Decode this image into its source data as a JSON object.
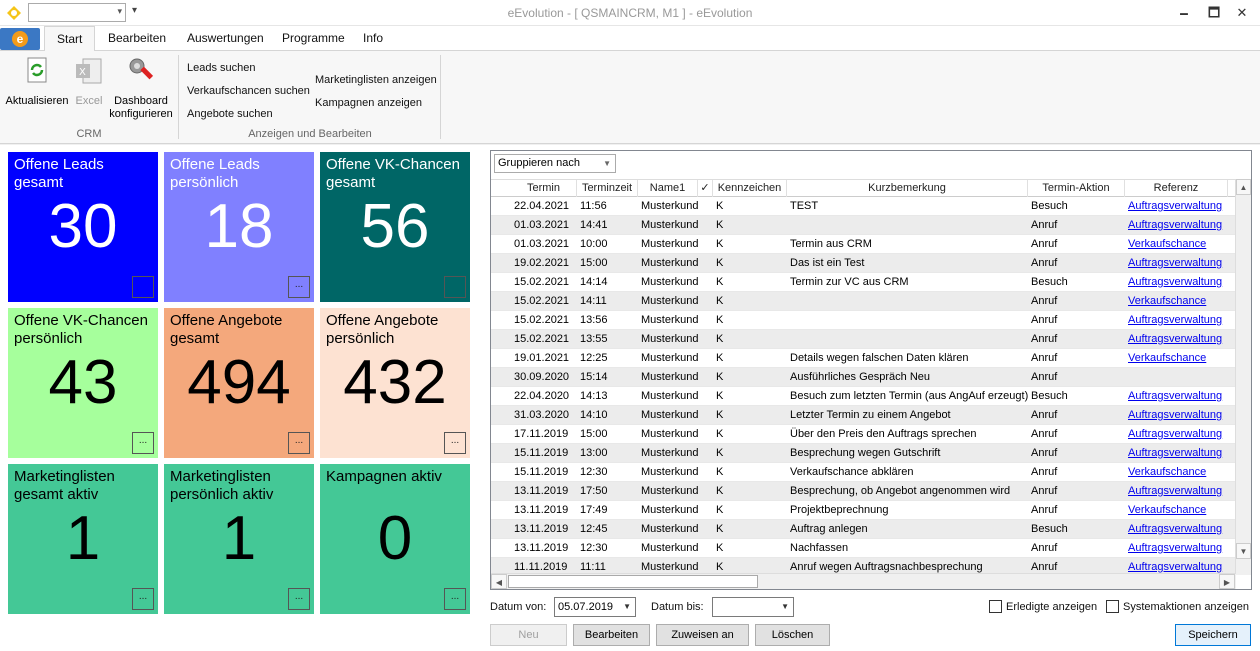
{
  "window": {
    "title": "eEvolution - [ QSMAINCRM, M1 ] -  eEvolution",
    "minimize": "🗕",
    "maximize": "🗖",
    "close": "✕",
    "quick_access_value": "",
    "quick_access_more": "▾"
  },
  "tabs": [
    {
      "label": "Start",
      "active": true
    },
    {
      "label": "Bearbeiten"
    },
    {
      "label": "Auswertungen"
    },
    {
      "label": "Programme"
    },
    {
      "label": "Info"
    }
  ],
  "app_button": "e",
  "ribbon": {
    "refresh": "Aktualisieren",
    "excel": "Excel",
    "dashboard_line1": "Dashboard",
    "dashboard_line2": "konfigurieren",
    "group_crm": "CRM",
    "leads_search": "Leads suchen",
    "opps_search": "Verkaufschancen suchen",
    "offers_search": "Angebote suchen",
    "marketing_lists": "Marketinglisten anzeigen",
    "campaigns": "Kampagnen anzeigen",
    "group_view_edit": "Anzeigen und Bearbeiten"
  },
  "tiles": [
    {
      "title": "Offene Leads gesamt",
      "value": "30",
      "bg": "#0000ff",
      "fg": "#ffffff",
      "btn": ""
    },
    {
      "title": "Offene Leads persönlich",
      "value": "18",
      "bg": "#8080ff",
      "fg": "#ffffff",
      "btn": "..."
    },
    {
      "title": "Offene VK-Chancen gesamt",
      "value": "56",
      "bg": "#006666",
      "fg": "#ffffff",
      "btn": ""
    },
    {
      "title": "Offene VK-Chancen persönlich",
      "value": "43",
      "bg": "#a6ff9c",
      "fg": "#000000",
      "btn": "..."
    },
    {
      "title": "Offene Angebote gesamt",
      "value": "494",
      "bg": "#f4a87c",
      "fg": "#000000",
      "btn": "..."
    },
    {
      "title": "Offene Angebote persönlich",
      "value": "432",
      "bg": "#fde2d2",
      "fg": "#000000",
      "btn": "..."
    },
    {
      "title": "Marketinglisten gesamt aktiv",
      "value": "1",
      "bg": "#44c896",
      "fg": "#000000",
      "btn": "..."
    },
    {
      "title": "Marketinglisten persönlich aktiv",
      "value": "1",
      "bg": "#44c896",
      "fg": "#000000",
      "btn": "..."
    },
    {
      "title": "Kampagnen aktiv",
      "value": "0",
      "bg": "#44c896",
      "fg": "#000000",
      "btn": "..."
    }
  ],
  "grid": {
    "group_by": "Gruppieren nach",
    "columns": [
      "Termin",
      "Terminzeit",
      "Name1",
      "✓",
      "Kennzeichen",
      "Kurzbemerkung",
      "Termin-Aktion",
      "Referenz"
    ],
    "rows": [
      [
        "22.04.2021",
        "11:56",
        "Musterkunde",
        "",
        "K",
        "TEST",
        "Besuch",
        "Auftragsverwaltung"
      ],
      [
        "01.03.2021",
        "14:41",
        "Musterkunde",
        "",
        "K",
        "",
        "Anruf",
        "Auftragsverwaltung"
      ],
      [
        "01.03.2021",
        "10:00",
        "Musterkunde",
        "",
        "K",
        "Termin aus CRM",
        "Anruf",
        "Verkaufschance"
      ],
      [
        "19.02.2021",
        "15:00",
        "Musterkunde",
        "",
        "K",
        "Das ist ein Test",
        "Anruf",
        "Auftragsverwaltung"
      ],
      [
        "15.02.2021",
        "14:14",
        "Musterkunde",
        "",
        "K",
        "Termin zur VC aus CRM",
        "Besuch",
        "Auftragsverwaltung"
      ],
      [
        "15.02.2021",
        "14:11",
        "Musterkunde",
        "",
        "K",
        "",
        "Anruf",
        "Verkaufschance"
      ],
      [
        "15.02.2021",
        "13:56",
        "Musterkunde",
        "",
        "K",
        "",
        "Anruf",
        "Auftragsverwaltung"
      ],
      [
        "15.02.2021",
        "13:55",
        "Musterkunde",
        "",
        "K",
        "",
        "Anruf",
        "Auftragsverwaltung"
      ],
      [
        "19.01.2021",
        "12:25",
        "Musterkunde",
        "",
        "K",
        "Details wegen falschen Daten klären",
        "Anruf",
        "Verkaufschance"
      ],
      [
        "30.09.2020",
        "15:14",
        "Musterkunde",
        "",
        "K",
        "Ausführliches Gespräch Neu",
        "Anruf",
        ""
      ],
      [
        "22.04.2020",
        "14:13",
        "Musterkunde",
        "",
        "K",
        "Besuch zum letzten Termin (aus AngAuf erzeugt)",
        "Besuch",
        "Auftragsverwaltung"
      ],
      [
        "31.03.2020",
        "14:10",
        "Musterkunde",
        "",
        "K",
        "Letzter Termin zu einem Angebot",
        "Anruf",
        "Auftragsverwaltung"
      ],
      [
        "17.11.2019",
        "15:00",
        "Musterkunde",
        "",
        "K",
        "Über den Preis den Auftrags sprechen",
        "Anruf",
        "Auftragsverwaltung"
      ],
      [
        "15.11.2019",
        "13:00",
        "Musterkunde",
        "",
        "K",
        "Besprechung wegen Gutschrift",
        "Anruf",
        "Auftragsverwaltung"
      ],
      [
        "15.11.2019",
        "12:30",
        "Musterkunde",
        "",
        "K",
        "Verkaufschance abklären",
        "Anruf",
        "Verkaufschance"
      ],
      [
        "13.11.2019",
        "17:50",
        "Musterkunde",
        "",
        "K",
        "Besprechung, ob Angebot angenommen wird",
        "Anruf",
        "Auftragsverwaltung"
      ],
      [
        "13.11.2019",
        "17:49",
        "Musterkunde",
        "",
        "K",
        "Projektbeprechnung",
        "Anruf",
        "Verkaufschance"
      ],
      [
        "13.11.2019",
        "12:45",
        "Musterkunde",
        "",
        "K",
        "Auftrag anlegen",
        "Besuch",
        "Auftragsverwaltung"
      ],
      [
        "13.11.2019",
        "12:30",
        "Musterkunde",
        "",
        "K",
        "Nachfassen",
        "Anruf",
        "Auftragsverwaltung"
      ],
      [
        "11.11.2019",
        "11:11",
        "Musterkunde",
        "",
        "K",
        "Anruf wegen Auftragsnachbesprechung",
        "Anruf",
        "Auftragsverwaltung"
      ]
    ]
  },
  "filters": {
    "date_from_label": "Datum von:",
    "date_from": "05.07.2019",
    "date_to_label": "Datum bis:",
    "date_to": "",
    "done_label": "Erledigte anzeigen",
    "system_label": "Systemaktionen anzeigen"
  },
  "buttons": {
    "new": "Neu",
    "edit": "Bearbeiten",
    "assign": "Zuweisen an",
    "delete": "Löschen",
    "save": "Speichern"
  },
  "colors": {
    "link": "#0000ee",
    "accent": "#3b78c4"
  }
}
